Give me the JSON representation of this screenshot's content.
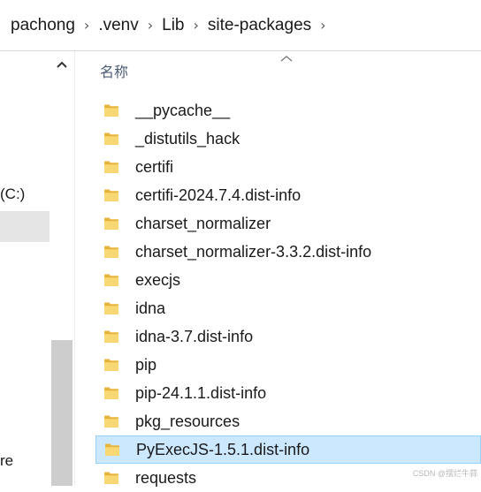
{
  "address_bar": {
    "crumbs": [
      "pachong",
      ".venv",
      "Lib",
      "site-packages"
    ],
    "separator": "›"
  },
  "nav_pane": {
    "drive_label": "(C:)",
    "partial_label": "re"
  },
  "column_header": {
    "name_label": "名称"
  },
  "files": [
    {
      "name": "__pycache__",
      "type": "folder",
      "selected": false
    },
    {
      "name": "_distutils_hack",
      "type": "folder",
      "selected": false
    },
    {
      "name": "certifi",
      "type": "folder",
      "selected": false
    },
    {
      "name": "certifi-2024.7.4.dist-info",
      "type": "folder",
      "selected": false
    },
    {
      "name": "charset_normalizer",
      "type": "folder",
      "selected": false
    },
    {
      "name": "charset_normalizer-3.3.2.dist-info",
      "type": "folder",
      "selected": false
    },
    {
      "name": "execjs",
      "type": "folder",
      "selected": false
    },
    {
      "name": "idna",
      "type": "folder",
      "selected": false
    },
    {
      "name": "idna-3.7.dist-info",
      "type": "folder",
      "selected": false
    },
    {
      "name": "pip",
      "type": "folder",
      "selected": false
    },
    {
      "name": "pip-24.1.1.dist-info",
      "type": "folder",
      "selected": false
    },
    {
      "name": "pkg_resources",
      "type": "folder",
      "selected": false
    },
    {
      "name": "PyExecJS-1.5.1.dist-info",
      "type": "folder",
      "selected": true
    },
    {
      "name": "requests",
      "type": "folder",
      "selected": false
    }
  ],
  "watermark": "CSDN @摆烂牛蒜",
  "colors": {
    "selection_bg": "#cce8ff",
    "selection_border": "#99d1ff",
    "folder_yellow": "#f8d775",
    "header_text": "#4c5b74"
  }
}
